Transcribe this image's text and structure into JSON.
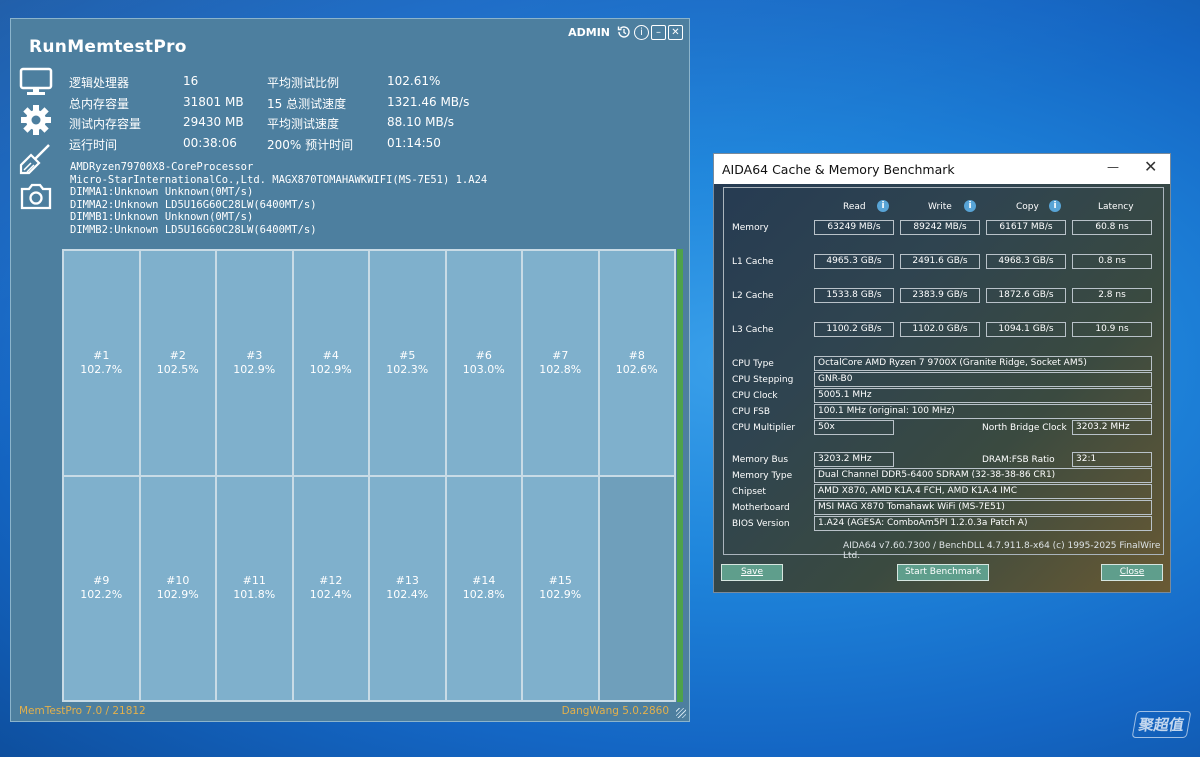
{
  "memtest": {
    "title": "RunMemtestPro",
    "admin_label": "ADMIN",
    "stats": [
      {
        "label1": "逻辑处理器",
        "value1": "16",
        "label2": "平均测试比例",
        "value2": "102.61%"
      },
      {
        "label1": "总内存容量",
        "value1": "31801 MB",
        "label2": "15 总测试速度",
        "value2": "1321.46 MB/s"
      },
      {
        "label1": "测试内存容量",
        "value1": "29430 MB",
        "label2": "平均测试速度",
        "value2": "88.10 MB/s"
      },
      {
        "label1": "运行时间",
        "value1": "00:38:06",
        "label2": "200% 预计时间",
        "value2": "01:14:50"
      }
    ],
    "sysinfo": [
      "AMDRyzen79700X8-CoreProcessor",
      "Micro-StarInternationalCo.,Ltd. MAGX870TOMAHAWKWIFI(MS-7E51) 1.A24",
      "DIMMA1:Unknown Unknown(0MT/s)",
      "DIMMA2:Unknown LD5U16G60C28LW(6400MT/s)",
      "DIMMB1:Unknown Unknown(0MT/s)",
      "DIMMB2:Unknown LD5U16G60C28LW(6400MT/s)"
    ],
    "threads": [
      {
        "id": "#1",
        "pct": "102.7%"
      },
      {
        "id": "#2",
        "pct": "102.5%"
      },
      {
        "id": "#3",
        "pct": "102.9%"
      },
      {
        "id": "#4",
        "pct": "102.9%"
      },
      {
        "id": "#5",
        "pct": "102.3%"
      },
      {
        "id": "#6",
        "pct": "103.0%"
      },
      {
        "id": "#7",
        "pct": "102.8%"
      },
      {
        "id": "#8",
        "pct": "102.6%"
      },
      {
        "id": "#9",
        "pct": "102.2%"
      },
      {
        "id": "#10",
        "pct": "102.9%"
      },
      {
        "id": "#11",
        "pct": "101.8%"
      },
      {
        "id": "#12",
        "pct": "102.4%"
      },
      {
        "id": "#13",
        "pct": "102.4%"
      },
      {
        "id": "#14",
        "pct": "102.8%"
      },
      {
        "id": "#15",
        "pct": "102.9%"
      }
    ],
    "footer_left": "MemTestPro 7.0 / 21812",
    "footer_right": "DangWang 5.0.2860",
    "icons": [
      "monitor-icon",
      "gear-icon",
      "broom-icon",
      "camera-icon",
      "history-icon",
      "info-icon",
      "minimize-icon",
      "close-icon"
    ]
  },
  "aida": {
    "title": "AIDA64 Cache & Memory Benchmark",
    "close_glyph": "✕",
    "minimize_glyph": "—",
    "headers": {
      "read": "Read",
      "write": "Write",
      "copy": "Copy",
      "latency": "Latency"
    },
    "bench": [
      {
        "label": "Memory",
        "read": "63249 MB/s",
        "write": "89242 MB/s",
        "copy": "61617 MB/s",
        "latency": "60.8 ns"
      },
      {
        "label": "L1 Cache",
        "read": "4965.3 GB/s",
        "write": "2491.6 GB/s",
        "copy": "4968.3 GB/s",
        "latency": "0.8 ns"
      },
      {
        "label": "L2 Cache",
        "read": "1533.8 GB/s",
        "write": "2383.9 GB/s",
        "copy": "1872.6 GB/s",
        "latency": "2.8 ns"
      },
      {
        "label": "L3 Cache",
        "read": "1100.2 GB/s",
        "write": "1102.0 GB/s",
        "copy": "1094.1 GB/s",
        "latency": "10.9 ns"
      }
    ],
    "cpu_type_label": "CPU Type",
    "cpu_type": "OctalCore AMD Ryzen 7 9700X  (Granite Ridge, Socket AM5)",
    "cpu_stepping_label": "CPU Stepping",
    "cpu_stepping": "GNR-B0",
    "cpu_clock_label": "CPU Clock",
    "cpu_clock": "5005.1 MHz",
    "cpu_fsb_label": "CPU FSB",
    "cpu_fsb": "100.1 MHz  (original: 100 MHz)",
    "cpu_mult_label": "CPU Multiplier",
    "cpu_mult": "50x",
    "nb_clock_label": "North Bridge Clock",
    "nb_clock": "3203.2 MHz",
    "mem_bus_label": "Memory Bus",
    "mem_bus": "3203.2 MHz",
    "dram_ratio_label": "DRAM:FSB Ratio",
    "dram_ratio": "32:1",
    "mem_type_label": "Memory Type",
    "mem_type": "Dual Channel DDR5-6400 SDRAM  (32-38-38-86 CR1)",
    "chipset_label": "Chipset",
    "chipset": "AMD X870, AMD K1A.4 FCH, AMD K1A.4 IMC",
    "motherboard_label": "Motherboard",
    "motherboard": "MSI MAG X870 Tomahawk WiFi (MS-7E51)",
    "bios_label": "BIOS Version",
    "bios": "1.A24  (AGESA: ComboAm5PI 1.2.0.3a Patch A)",
    "copyright": "AIDA64 v7.60.7300 / BenchDLL 4.7.911.8-x64  (c) 1995-2025 FinalWire Ltd.",
    "buttons": {
      "save": "Save",
      "start": "Start Benchmark",
      "close": "Close"
    }
  },
  "watermark": "聚超值"
}
